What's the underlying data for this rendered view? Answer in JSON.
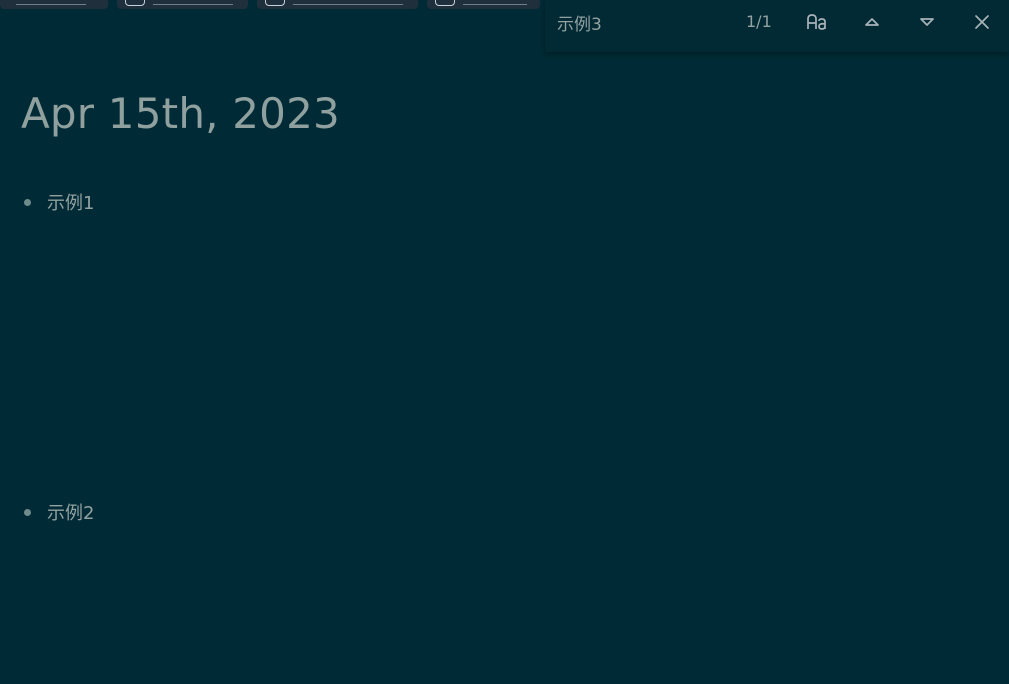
{
  "page": {
    "title": "Apr 15th, 2023"
  },
  "blocks": [
    {
      "text": "示例1"
    },
    {
      "text": "示例2"
    }
  ],
  "search": {
    "query": "示例3",
    "match_count": "1/1",
    "icons": {
      "case": "match-case-icon",
      "prev": "arrow-up-icon",
      "next": "arrow-down-icon",
      "close": "close-icon"
    }
  },
  "colors": {
    "background": "#002b36",
    "text": "#93a1a1",
    "title": "#8fa09f",
    "bullet": "#6f8c8d",
    "find_bar": "#012a35"
  }
}
